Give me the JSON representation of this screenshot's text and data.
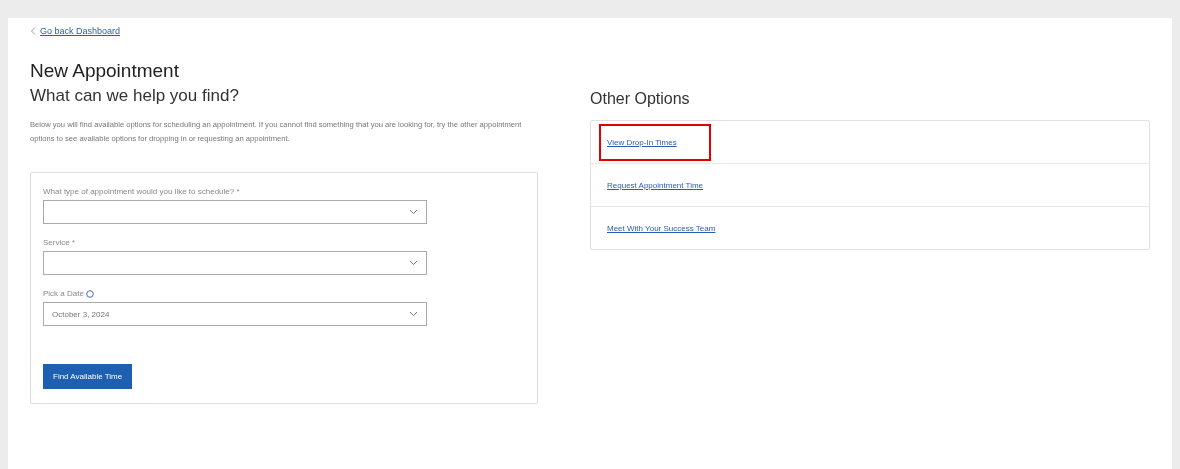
{
  "back_link": "Go back Dashboard",
  "title": "New Appointment",
  "subtitle": "What can we help you find?",
  "intro": "Below you will find available options for scheduling an appointment. If you cannot find something that you are looking for, try the other appointment options to see available options for dropping in or requesting an appointment.",
  "form": {
    "fields": [
      {
        "label": "What type of appointment would you like to schedule? *",
        "info": false
      },
      {
        "label": "Service *",
        "info": false
      },
      {
        "label": "Pick a Date",
        "value": "October 3, 2024",
        "info": true
      }
    ],
    "submit": "Find Available Time"
  },
  "other_options": {
    "title": "Other Options",
    "items": [
      {
        "label": "View Drop-In Times",
        "highlighted": true
      },
      {
        "label": "Request Appointment Time",
        "highlighted": false
      },
      {
        "label": "Meet With Your Success Team",
        "highlighted": false
      }
    ]
  }
}
